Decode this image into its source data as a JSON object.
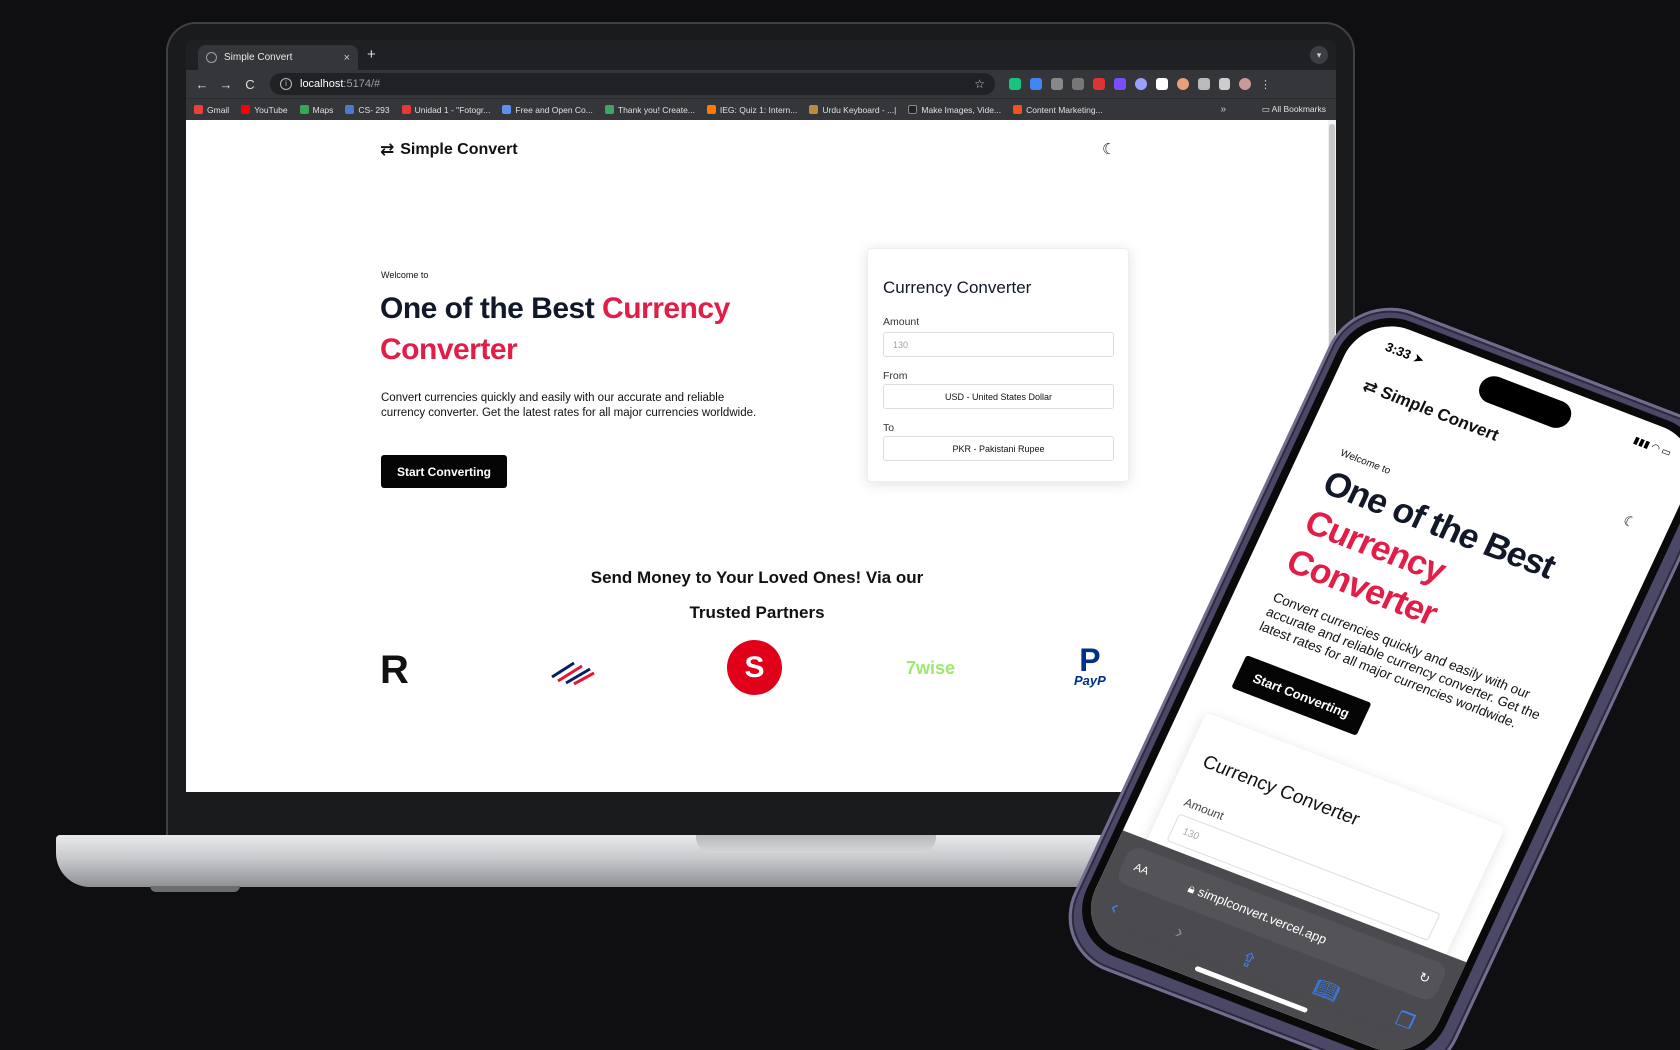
{
  "browser": {
    "tab_title": "Simple Convert",
    "tab_close": "×",
    "new_tab": "+",
    "nav_back": "←",
    "nav_forward": "→",
    "nav_reload": "C",
    "url_host": "localhost",
    "url_path": ":5174/#",
    "bookmarks": [
      "Gmail",
      "YouTube",
      "Maps",
      "CS- 293",
      "Unidad 1 - \"Fotogr...",
      "Free and Open Co...",
      "Thank you! Create...",
      "IEG: Quiz 1: Intern...",
      "Urdu Keyboard - ...|",
      "Make Images, Vide...",
      "Content Marketing..."
    ],
    "bookmark_more": "»",
    "all_bookmarks": "All Bookmarks"
  },
  "site": {
    "logo_icon": "⇄",
    "brand": "Simple Convert",
    "theme_icon": "☾",
    "welcome": "Welcome to",
    "hero_line1": "One of the Best ",
    "hero_accent": "Currency Converter",
    "description": "Convert currencies quickly and easily with our accurate and reliable currency converter. Get the latest rates for all major currencies worldwide.",
    "cta": "Start Converting",
    "converter": {
      "title": "Currency Converter",
      "amount_label": "Amount",
      "amount_placeholder": "130",
      "from_label": "From",
      "from_value": "USD - United States Dollar",
      "to_label": "To",
      "to_value": "PKR - Pakistani Rupee"
    },
    "partners_title_1": "Send Money to Your Loved Ones! Via our",
    "partners_title_2": "Trusted Partners",
    "partners": {
      "revolut": "R",
      "sparkasse": "S",
      "wise": "7wise",
      "paypal": "P",
      "paypal_text": "PayP"
    }
  },
  "phone": {
    "time": "3:33",
    "url_aa": "AA",
    "url_domain": "simplconvert.vercel.app",
    "nav_back": "‹",
    "nav_forward": "›"
  },
  "colors": {
    "accent": "#e11d48",
    "dark": "#111827",
    "button": "#050505"
  }
}
